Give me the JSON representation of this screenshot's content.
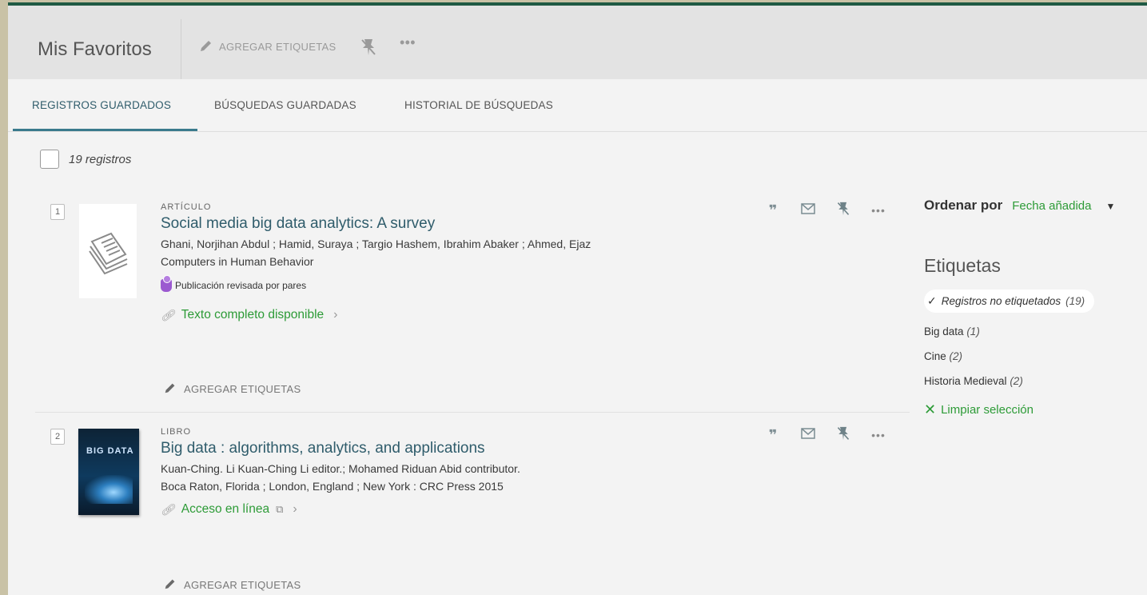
{
  "header": {
    "title": "Mis Favoritos",
    "add_tags_label": "AGREGAR ETIQUETAS",
    "more_label": "•••"
  },
  "tabs": [
    {
      "label": "REGISTROS GUARDADOS",
      "active": true
    },
    {
      "label": "BÚSQUEDAS GUARDADAS",
      "active": false
    },
    {
      "label": "HISTORIAL DE BÚSQUEDAS",
      "active": false
    }
  ],
  "results_count": "19 registros",
  "records": [
    {
      "number": "1",
      "type": "ARTÍCULO",
      "title": "Social media big data analytics: A survey",
      "authors": "Ghani, Norjihan Abdul ; Hamid, Suraya ; Targio Hashem, Ibrahim Abaker ; Ahmed, Ejaz",
      "source": "Computers in Human Behavior",
      "peer_reviewed": "Publicación revisada por pares",
      "availability": "Texto completo disponible",
      "add_tags": "AGREGAR ETIQUETAS"
    },
    {
      "number": "2",
      "type": "LIBRO",
      "title": "Big data : algorithms, analytics, and applications",
      "authors": "Kuan-Ching. Li Kuan-Ching Li editor.; Mohamed Riduan Abid contributor.",
      "source": "Boca Raton, Florida ; London, England ; New York : CRC Press 2015",
      "availability": "Acceso en línea",
      "cover_text": "BIG DATA",
      "add_tags": "AGREGAR ETIQUETAS"
    }
  ],
  "record_actions": {
    "cite": "❞",
    "email": "✉",
    "unpin": "📌",
    "more": "•••"
  },
  "sidebar": {
    "sort_label": "Ordenar por",
    "sort_value": "Fecha añadida",
    "tags_heading": "Etiquetas",
    "active_tag": {
      "label": "Registros no etiquetados",
      "count": "(19)"
    },
    "tags": [
      {
        "label": "Big data",
        "count": "(1)"
      },
      {
        "label": "Cine",
        "count": "(2)"
      },
      {
        "label": "Historia Medieval",
        "count": "(2)"
      }
    ],
    "clear_label": "Limpiar selección"
  },
  "colors": {
    "accent_teal": "#2f5c6b",
    "link_green": "#2d9b37",
    "top_border": "#1f5a44",
    "peer_purple": "#9b59d0"
  }
}
